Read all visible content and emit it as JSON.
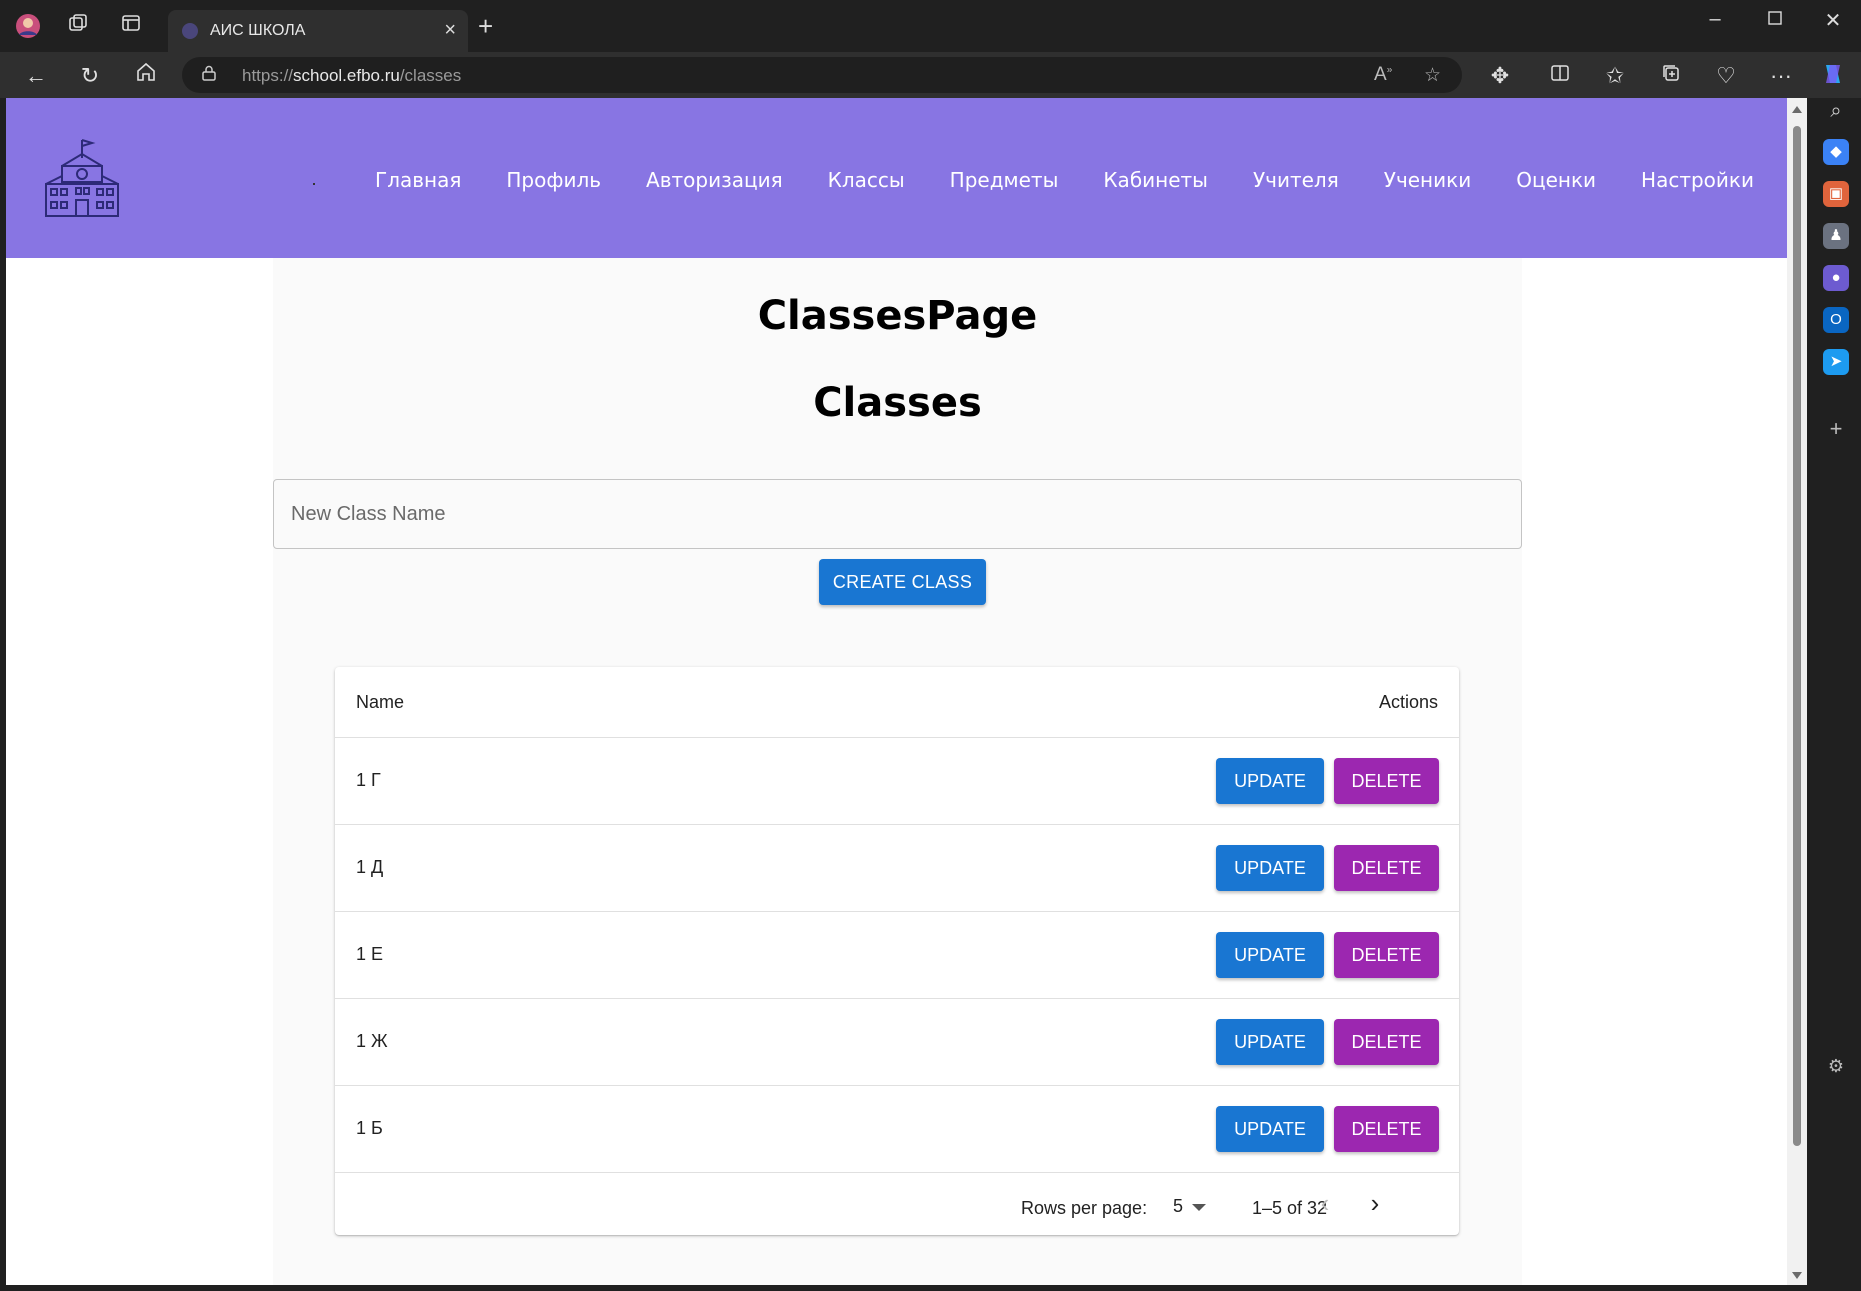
{
  "browser": {
    "tab_title": "АИС ШКОЛА",
    "url_prefix": "https://",
    "url_host": "school.efbo.ru",
    "url_path": "/classes"
  },
  "site": {
    "nav": [
      "Главная",
      "Профиль",
      "Авторизация",
      "Классы",
      "Предметы",
      "Кабинеты",
      "Учителя",
      "Ученики",
      "Оценки",
      "Настройки"
    ]
  },
  "page": {
    "title": "ClassesPage",
    "subtitle": "Classes",
    "input_placeholder": "New Class Name",
    "create_label": "CREATE CLASS"
  },
  "table": {
    "headers": {
      "name": "Name",
      "actions": "Actions"
    },
    "rows": [
      {
        "name": "1 Г"
      },
      {
        "name": "1 Д"
      },
      {
        "name": "1 Е"
      },
      {
        "name": "1 Ж"
      },
      {
        "name": "1 Б"
      }
    ],
    "update_label": "UPDATE",
    "delete_label": "DELETE",
    "rows_per_page_label": "Rows per page:",
    "rows_per_page_value": "5",
    "range_text": "1–5 of 32"
  },
  "colors": {
    "header_bg": "#8875e3",
    "primary": "#1976d2",
    "secondary": "#9c27b0"
  }
}
